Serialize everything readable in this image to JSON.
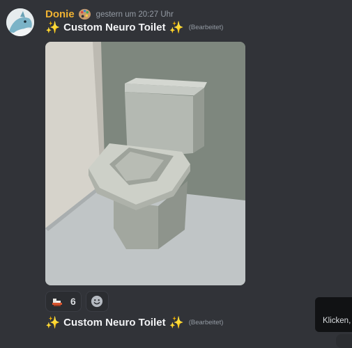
{
  "message": {
    "author": "Donie",
    "role_icon": "palette-icon",
    "timestamp": "gestern um 20:27 Uhr",
    "text": "Custom Neuro Toilet",
    "sparkle_icon": "✨",
    "edited_label": "(Bearbeitet)",
    "attachment": {
      "description_icon": "toilet-render-image"
    },
    "reactions": [
      {
        "icon": "toilet-emoji-icon",
        "count": "6"
      }
    ],
    "add_reaction_icon": "smiley-icon"
  },
  "reply_preview": {
    "text": "Custom Neuro Toilet",
    "edited_label": "(Bearbeitet)"
  },
  "tooltip": {
    "text": "Klicken,"
  },
  "colors": {
    "background": "#313338",
    "username": "#f0b232",
    "muted": "#949ba4",
    "sparkle": "#f5c542"
  }
}
